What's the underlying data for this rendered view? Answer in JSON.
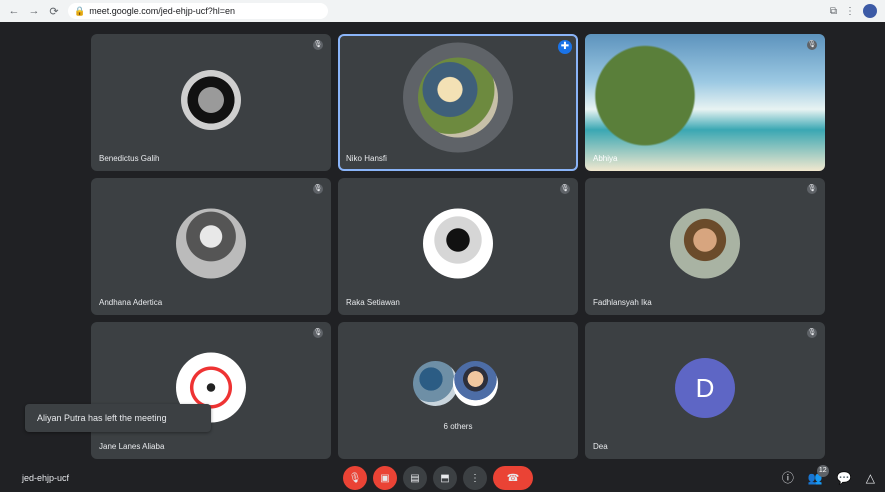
{
  "browser": {
    "url": "meet.google.com/jed-ehjp-ucf?hl=en",
    "icons": [
      "back-icon",
      "forward-icon",
      "reload-icon",
      "lock-icon",
      "extensions-icon",
      "menu-icon",
      "profile-icon"
    ]
  },
  "tiles": [
    {
      "name": "Benedictus Galih",
      "muted": true,
      "avatar": "car"
    },
    {
      "name": "Niko Hansfi",
      "muted": false,
      "pinned": true,
      "avatar": "group-photo"
    },
    {
      "name": "Abhiya",
      "muted": true,
      "avatar": "beach"
    },
    {
      "name": "Andhana Adertica",
      "muted": true,
      "avatar": "bw-person"
    },
    {
      "name": "Raka Setiawan",
      "muted": true,
      "avatar": "masked-person"
    },
    {
      "name": "Fadhlansyah Ika",
      "muted": true,
      "avatar": "masked-man"
    },
    {
      "name": "Jane Lanes Aliaba",
      "muted": true,
      "avatar": "warning-sign"
    },
    {
      "name": "6 others",
      "muted": false,
      "avatar": "dual"
    },
    {
      "name": "Dea",
      "muted": true,
      "avatar": "letter-d",
      "avatar_letter": "D"
    }
  ],
  "toast": {
    "text": "Aliyan Putra has left the meeting"
  },
  "bottom": {
    "meeting_code": "jed-ehjp-ucf",
    "participants_count": "12"
  },
  "colors": {
    "accent": "#1a73e8",
    "danger": "#ea4335",
    "tile": "#3c4043",
    "bg": "#202124"
  }
}
